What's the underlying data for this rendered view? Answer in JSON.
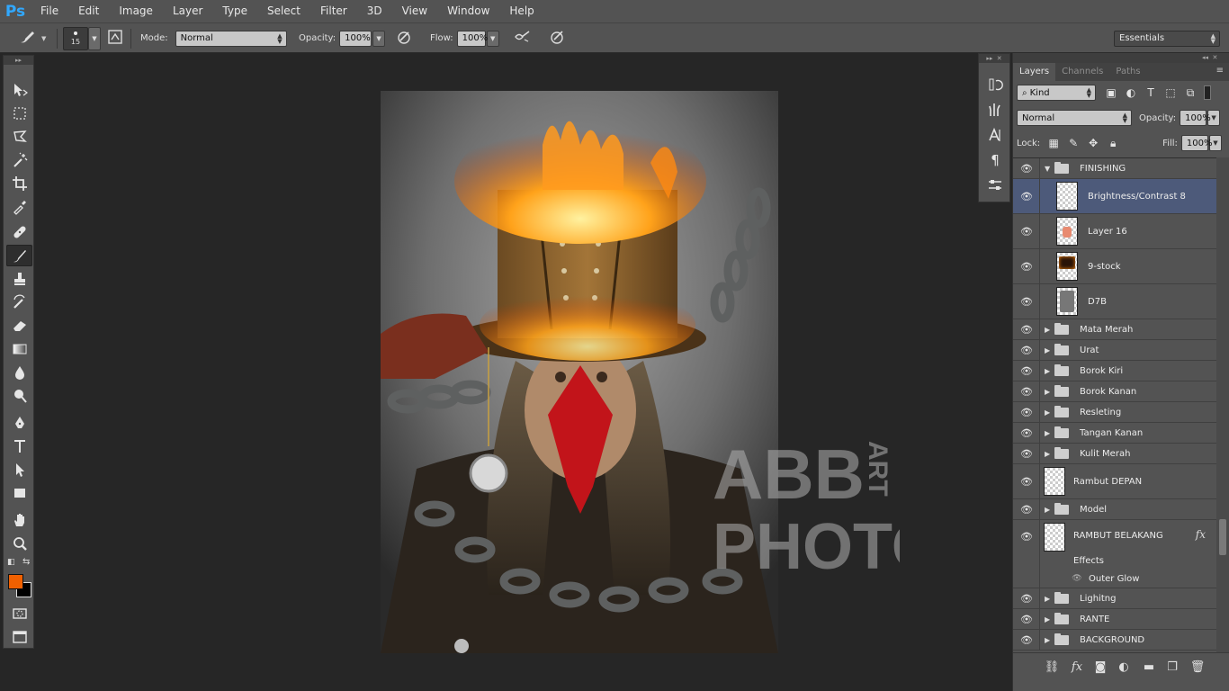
{
  "app": {
    "logo": "Ps"
  },
  "menu": [
    "File",
    "Edit",
    "Image",
    "Layer",
    "Type",
    "Select",
    "Filter",
    "3D",
    "View",
    "Window",
    "Help"
  ],
  "options_bar": {
    "brush_size": "15",
    "mode_label": "Mode:",
    "mode_value": "Normal",
    "opacity_label": "Opacity:",
    "opacity_value": "100%",
    "flow_label": "Flow:",
    "flow_value": "100%",
    "workspace": "Essentials"
  },
  "tools": [
    "move-tool",
    "marquee-tool",
    "lasso-tool",
    "magic-wand-tool",
    "crop-tool",
    "eyedropper-tool",
    "healing-brush-tool",
    "brush-tool",
    "clone-stamp-tool",
    "history-brush-tool",
    "eraser-tool",
    "gradient-tool",
    "blur-tool",
    "dodge-tool",
    "pen-tool",
    "type-tool",
    "path-selection-tool",
    "rectangle-tool",
    "hand-tool",
    "zoom-tool"
  ],
  "active_tool": "brush-tool",
  "colors": {
    "foreground": "#f06000",
    "background": "#000000",
    "selection": "#4d5a7a"
  },
  "watermark": {
    "line1": "ABB",
    "line2": "PHOTO",
    "side": "ART"
  },
  "layers_panel": {
    "tabs": [
      "Layers",
      "Channels",
      "Paths"
    ],
    "filter_kind": "Kind",
    "blend_mode": "Normal",
    "opacity_label": "Opacity:",
    "opacity_value": "100%",
    "lock_label": "Lock:",
    "fill_label": "Fill:",
    "fill_value": "100%",
    "layers": [
      {
        "name": "FINISHING",
        "kind": "group-open"
      },
      {
        "name": "Brightness/Contrast 8",
        "kind": "adjustment",
        "selected": true
      },
      {
        "name": "Layer 16",
        "kind": "pixel"
      },
      {
        "name": "9-stock",
        "kind": "pixel"
      },
      {
        "name": "D7B",
        "kind": "pixel"
      },
      {
        "name": "Mata Merah",
        "kind": "group"
      },
      {
        "name": "Urat",
        "kind": "group"
      },
      {
        "name": "Borok Kiri",
        "kind": "group"
      },
      {
        "name": "Borok Kanan",
        "kind": "group"
      },
      {
        "name": "Resleting",
        "kind": "group"
      },
      {
        "name": "Tangan Kanan",
        "kind": "group"
      },
      {
        "name": "Kulit Merah",
        "kind": "group"
      },
      {
        "name": "Rambut DEPAN",
        "kind": "pixel"
      },
      {
        "name": "Model",
        "kind": "group"
      },
      {
        "name": "RAMBUT BELAKANG",
        "kind": "pixel-fx"
      },
      {
        "name": "Effects",
        "kind": "effects"
      },
      {
        "name": "Outer Glow",
        "kind": "effect"
      },
      {
        "name": "Lighitng",
        "kind": "group"
      },
      {
        "name": "RANTE",
        "kind": "group"
      },
      {
        "name": "BACKGROUND",
        "kind": "group"
      }
    ]
  }
}
